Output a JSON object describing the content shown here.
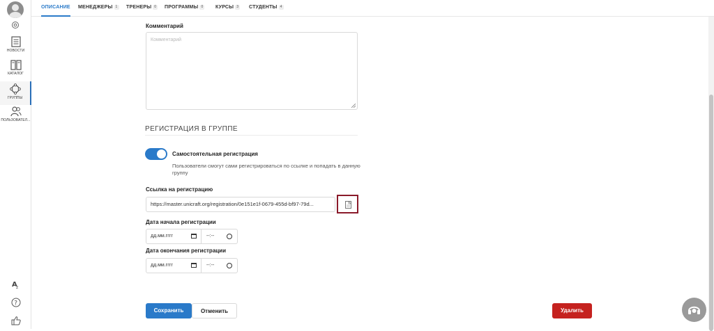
{
  "sidebar": {
    "items": [
      {
        "label": "НОВОСТИ",
        "icon": "news-icon"
      },
      {
        "label": "КАТАЛОГ",
        "icon": "catalog-icon"
      },
      {
        "label": "ГРУППЫ",
        "icon": "groups-icon",
        "active": true
      },
      {
        "label": "ПОЛЬЗОВАТЕЛ...",
        "icon": "users-icon"
      }
    ],
    "bottom_icons": [
      "translate-icon",
      "help-icon",
      "thumbs-up-icon"
    ]
  },
  "tabs": [
    {
      "label": "ОПИСАНИЕ",
      "count": "",
      "active": true
    },
    {
      "label": "МЕНЕДЖЕРЫ",
      "count": "1"
    },
    {
      "label": "ТРЕНЕРЫ",
      "count": "0"
    },
    {
      "label": "ПРОГРАММЫ",
      "count": "0"
    },
    {
      "label": "КУРСЫ",
      "count": "3"
    },
    {
      "label": "СТУДЕНТЫ",
      "count": "4"
    }
  ],
  "form": {
    "comment_label": "Комментарий",
    "comment_placeholder": "Комментарий",
    "registration_section_title": "РЕГИСТРАЦИЯ В ГРУППЕ",
    "self_registration": {
      "title": "Самостоятельная регистрация",
      "description": "Пользователи смогут сами регистрироваться по ссылке и попадать в данную группу",
      "enabled": true
    },
    "link_label": "Ссылка на регистрацию",
    "link_value": "https://master.unicraft.org/registration/0e151e1f-0679-455d-bf97-79d...",
    "start_label": "Дата начала регистрации",
    "end_label": "Дата окончания регистрации",
    "date_placeholder": "дд.мм.гггг",
    "time_placeholder": "--:--"
  },
  "buttons": {
    "save": "Сохранить",
    "cancel": "Отменить",
    "delete": "Удалить"
  },
  "colors": {
    "accent": "#2a7ac9",
    "danger": "#c5221f",
    "highlight_border": "#8a1a2a"
  }
}
